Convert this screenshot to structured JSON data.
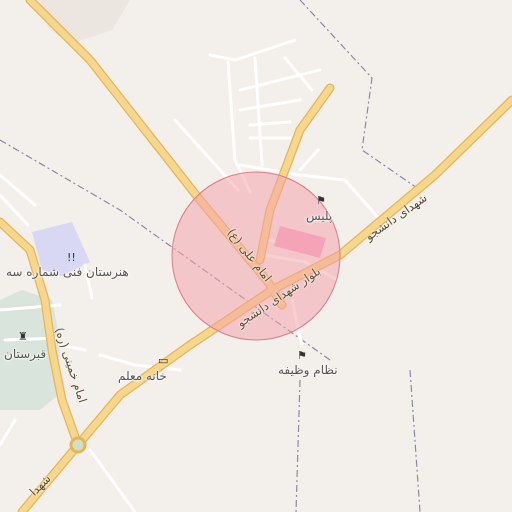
{
  "map": {
    "labels": {
      "police": "پلیس",
      "school": "هنرستان فنی شماره سه",
      "cemetery": "قبرستان",
      "teacher_house": "خانه معلم",
      "military": "نظام وظیفه"
    },
    "roads": {
      "imam_ali": "امام علی (ع)",
      "boulevard": "بلوار شهدای دانشجو",
      "shohada_daneshjoo": "شهدای دانشجو",
      "imam_khomeini": "امام خمینی (ره)",
      "shohada": "شهدا"
    },
    "colors": {
      "background": "#f3efea",
      "major_road": "#f7d68e",
      "major_road_casing": "#e8b45a",
      "minor_road": "#ffffff",
      "highlight_circle": "#f4a9b0",
      "pink_area": "#f7a8c8",
      "green_area": "#d9e4dc",
      "school_area": "#d8d8f4"
    },
    "icons": [
      "police-icon",
      "school-icon",
      "cemetery-icon",
      "teacher-house-icon",
      "military-icon"
    ]
  }
}
